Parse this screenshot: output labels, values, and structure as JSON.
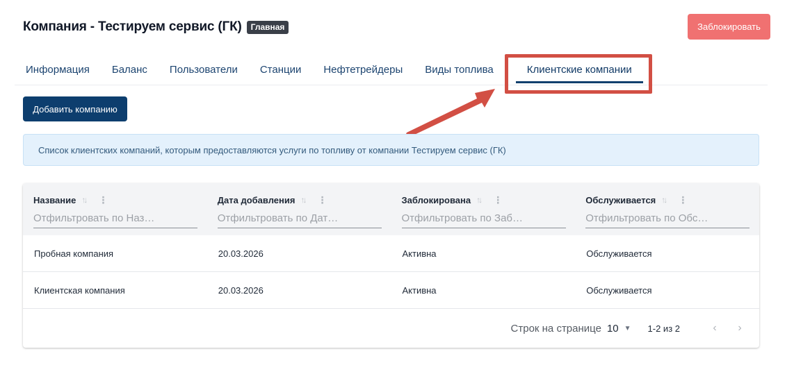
{
  "header": {
    "title": "Компания - Тестируем сервис (ГК)",
    "badge": "Главная",
    "block_label": "Заблокировать"
  },
  "tabs": [
    {
      "label": "Информация"
    },
    {
      "label": "Баланс"
    },
    {
      "label": "Пользователи"
    },
    {
      "label": "Станции"
    },
    {
      "label": "Нефтетрейдеры"
    },
    {
      "label": "Виды топлива"
    },
    {
      "label": "Клиентские компании",
      "active": true
    }
  ],
  "add_button": "Добавить компанию",
  "info_text": "Список клиентских компаний, которым предоставляются услуги по топливу от компании Тестируем сервис (ГК)",
  "table": {
    "columns": [
      {
        "label": "Название",
        "placeholder": "Отфильтровать по Наз…"
      },
      {
        "label": "Дата добавления",
        "placeholder": "Отфильтровать по Дат…"
      },
      {
        "label": "Заблокирована",
        "placeholder": "Отфильтровать по Заб…"
      },
      {
        "label": "Обслуживается",
        "placeholder": "Отфильтровать по Обс…"
      }
    ],
    "rows": [
      [
        "Пробная компания",
        "20.03.2026",
        "Активна",
        "Обслуживается"
      ],
      [
        "Клиентская компания",
        "20.03.2026",
        "Активна",
        "Обслуживается"
      ]
    ]
  },
  "pagination": {
    "rows_label": "Строк на странице",
    "rows_value": "10",
    "range": "1-2 из 2"
  },
  "colors": {
    "primary": "#0d3e6e",
    "danger": "#f07171",
    "annotation": "#d24f44"
  }
}
